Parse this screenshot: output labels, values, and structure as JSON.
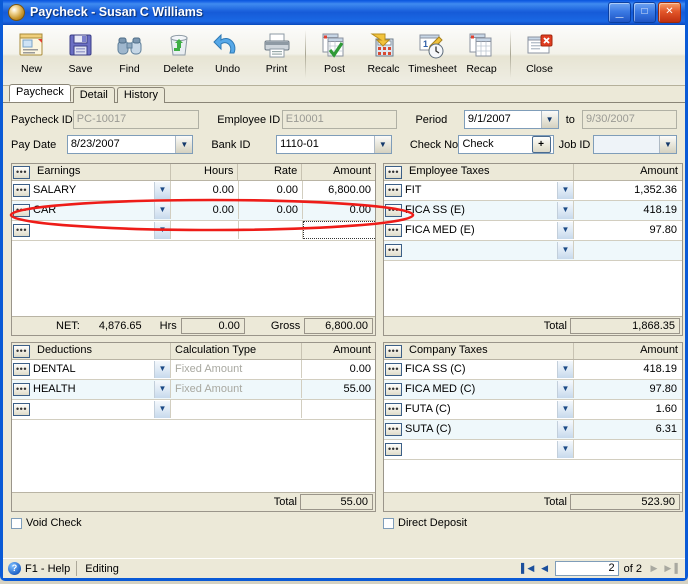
{
  "window": {
    "title": "Paycheck - Susan C Williams",
    "icon": "paycheck-app-icon",
    "buttons": {
      "minimize": "_",
      "maximize": "□",
      "close": "✕"
    }
  },
  "toolbar": {
    "items": [
      {
        "label": "New",
        "icon": "new-document-icon"
      },
      {
        "label": "Save",
        "icon": "floppy-disk-icon"
      },
      {
        "label": "Find",
        "icon": "binoculars-icon"
      },
      {
        "label": "Delete",
        "icon": "recycle-bin-icon"
      },
      {
        "label": "Undo",
        "icon": "undo-arrow-icon"
      },
      {
        "label": "Print",
        "icon": "printer-icon"
      },
      {
        "label": "Post",
        "icon": "post-checkmark-icon"
      },
      {
        "label": "Recalc",
        "icon": "calculator-icon"
      },
      {
        "label": "Timesheet",
        "icon": "clock-timesheet-icon"
      },
      {
        "label": "Recap",
        "icon": "recap-report-icon"
      },
      {
        "label": "Close",
        "icon": "close-window-icon"
      }
    ]
  },
  "tabs": [
    {
      "label": "Paycheck",
      "active": true
    },
    {
      "label": "Detail",
      "active": false
    },
    {
      "label": "History",
      "active": false
    }
  ],
  "form": {
    "paycheck_id_label": "Paycheck ID",
    "paycheck_id_value": "PC-10017",
    "employee_id_label": "Employee ID",
    "employee_id_value": "E10001",
    "period_label": "Period",
    "period_from_value": "9/1/2007",
    "period_to_label": "to",
    "period_to_value": "9/30/2007",
    "pay_date_label": "Pay Date",
    "pay_date_value": "8/23/2007",
    "bank_id_label": "Bank ID",
    "bank_id_value": "1110-01",
    "check_no_label": "Check No",
    "check_no_value": "Check",
    "check_no_plus": "+",
    "job_id_label": "Job ID",
    "job_id_value": ""
  },
  "earnings": {
    "columns": [
      "Earnings",
      "Hours",
      "Rate",
      "Amount"
    ],
    "rows": [
      {
        "name": "SALARY",
        "hours": "0.00",
        "rate": "0.00",
        "amount": "6,800.00"
      },
      {
        "name": "CAR",
        "hours": "0.00",
        "rate": "0.00",
        "amount": "0.00"
      },
      {
        "name": "",
        "hours": "",
        "rate": "",
        "amount": ""
      }
    ],
    "net_label": "NET:",
    "net_value": "4,876.65",
    "hrs_label": "Hrs",
    "hrs_value": "0.00",
    "gross_label": "Gross",
    "gross_value": "6,800.00"
  },
  "employee_taxes": {
    "columns": [
      "Employee Taxes",
      "Amount"
    ],
    "rows": [
      {
        "name": "FIT",
        "amount": "1,352.36"
      },
      {
        "name": "FICA SS (E)",
        "amount": "418.19"
      },
      {
        "name": "FICA MED (E)",
        "amount": "97.80"
      },
      {
        "name": "",
        "amount": ""
      }
    ],
    "total_label": "Total",
    "total_value": "1,868.35"
  },
  "deductions": {
    "columns": [
      "Deductions",
      "Calculation Type",
      "Amount"
    ],
    "rows": [
      {
        "name": "DENTAL",
        "calc": "Fixed Amount",
        "amount": "0.00"
      },
      {
        "name": "HEALTH",
        "calc": "Fixed Amount",
        "amount": "55.00"
      },
      {
        "name": "",
        "calc": "",
        "amount": ""
      }
    ],
    "total_label": "Total",
    "total_value": "55.00"
  },
  "company_taxes": {
    "columns": [
      "Company Taxes",
      "Amount"
    ],
    "rows": [
      {
        "name": "FICA SS (C)",
        "amount": "418.19"
      },
      {
        "name": "FICA MED (C)",
        "amount": "97.80"
      },
      {
        "name": "FUTA (C)",
        "amount": "1.60"
      },
      {
        "name": "SUTA (C)",
        "amount": "6.31"
      },
      {
        "name": "",
        "amount": ""
      }
    ],
    "total_label": "Total",
    "total_value": "523.90"
  },
  "checkboxes": {
    "void_check_label": "Void Check",
    "direct_deposit_label": "Direct Deposit"
  },
  "statusbar": {
    "help_label": "F1 - Help",
    "help_icon": "question-mark-icon",
    "mode": "Editing",
    "nav": {
      "first": "▌◀",
      "prev": "◀",
      "record": "2",
      "of_label": "of 2",
      "next": "▶",
      "last": "▶▐"
    }
  },
  "annotation": {
    "shape": "red-ellipse",
    "color": "#ee1c18",
    "target": "earnings-row-car"
  },
  "colors": {
    "titlebar": "#1a62dd",
    "panel": "#ece9d8",
    "alt_row": "#eff8fb",
    "accent": "#ee1c18"
  }
}
